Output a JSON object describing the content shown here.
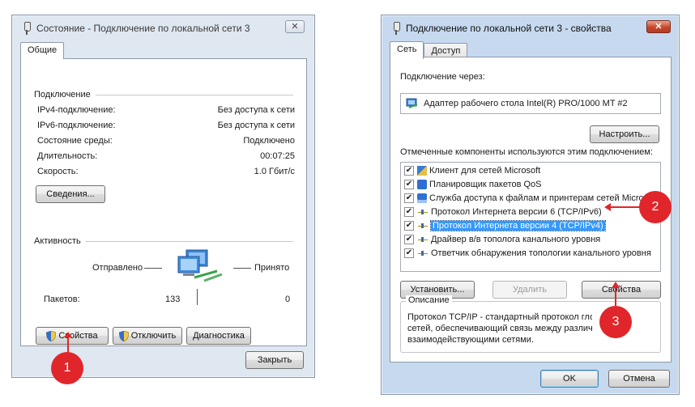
{
  "status_window": {
    "title": "Состояние - Подключение по локальной сети 3",
    "close_glyph": "✕",
    "tab": "Общие",
    "connection": {
      "group_label": "Подключение",
      "rows": [
        {
          "label": "IPv4-подключение:",
          "value": "Без доступа к сети"
        },
        {
          "label": "IPv6-подключение:",
          "value": "Без доступа к сети"
        },
        {
          "label": "Состояние среды:",
          "value": "Подключено"
        },
        {
          "label": "Длительность:",
          "value": "00:07:25"
        },
        {
          "label": "Скорость:",
          "value": "1.0 Гбит/с"
        }
      ],
      "details_button": "Сведения..."
    },
    "activity": {
      "group_label": "Активность",
      "sent_label": "Отправлено",
      "received_label": "Принято",
      "packets_label": "Пакетов:",
      "sent_value": "133",
      "received_value": "0"
    },
    "buttons": {
      "properties": "Свойства",
      "disable": "Отключить",
      "diagnose": "Диагностика",
      "close": "Закрыть"
    }
  },
  "properties_window": {
    "title": "Подключение по локальной сети 3 - свойства",
    "close_glyph": "✕",
    "tabs": [
      "Сеть",
      "Доступ"
    ],
    "connect_using_label": "Подключение через:",
    "adapter_name": "Адаптер рабочего стола Intel(R) PRO/1000 MT #2",
    "configure_button": "Настроить...",
    "components_label": "Отмеченные компоненты используются этим подключением:",
    "components": [
      {
        "label": "Клиент для сетей Microsoft",
        "checked": true,
        "icon": "client-icon"
      },
      {
        "label": "Планировщик пакетов QoS",
        "checked": true,
        "icon": "qos-icon"
      },
      {
        "label": "Служба доступа к файлам и принтерам сетей Micro...",
        "checked": true,
        "icon": "share-icon"
      },
      {
        "label": "Протокол Интернета версии 6 (TCP/IPv6)",
        "checked": true,
        "icon": "protocol-icon"
      },
      {
        "label": "Протокол Интернета версии 4 (TCP/IPv4)",
        "checked": true,
        "icon": "protocol-icon",
        "selected": true
      },
      {
        "label": "Драйвер в/в тополога канального уровня",
        "checked": true,
        "icon": "protocol-icon"
      },
      {
        "label": "Ответчик обнаружения топологии канального уровня",
        "checked": true,
        "icon": "protocol-icon"
      }
    ],
    "check_glyph": "✔",
    "install_button": "Установить...",
    "remove_button": "Удалить",
    "properties_button": "Свойства",
    "description_label": "Описание",
    "description_lines": [
      "Протокол TCP/IP - стандартный протокол глобальных",
      "сетей, обеспечивающий связь между различными",
      "взаимодействующими сетями."
    ],
    "ok_button": "OK",
    "cancel_button": "Отмена"
  },
  "callouts": [
    "1",
    "2",
    "3"
  ],
  "colors": {
    "callout": "#e0262b",
    "selection": "#3399ff"
  }
}
